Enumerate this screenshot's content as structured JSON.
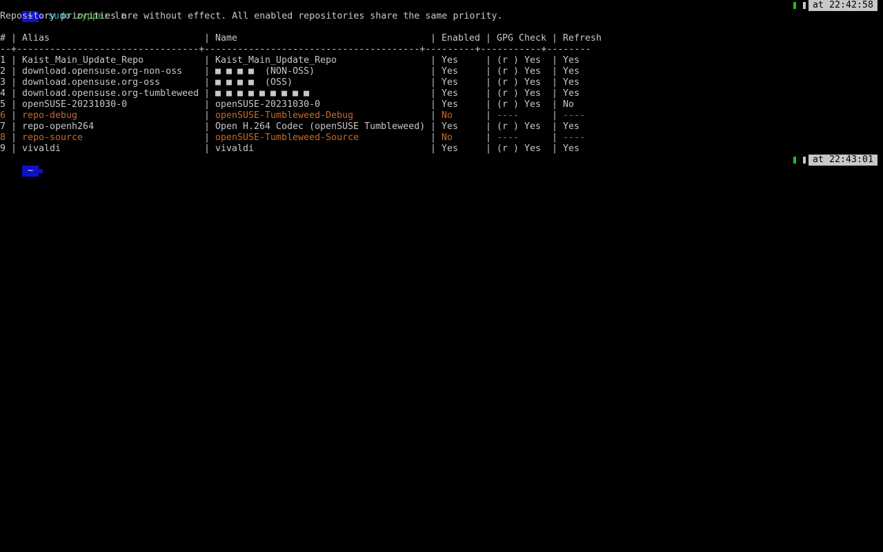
{
  "prompt1": {
    "home": "~",
    "cmd_sudo": "sudo",
    "cmd_zypper": "zypper",
    "cmd_arg": "lr",
    "time": "at 22:42:58"
  },
  "message": "Repository priorities are without effect. All enabled repositories share the same priority.",
  "table": {
    "headers": {
      "num": "#",
      "alias": "Alias",
      "name": "Name",
      "enabled": "Enabled",
      "gpg": "GPG Check",
      "refresh": "Refresh"
    },
    "divider": "--+---------------------------------+---------------------------------------+---------+-----------+--------",
    "rows": [
      {
        "num": "1",
        "alias": "Kaist_Main_Update_Repo",
        "name": "Kaist_Main_Update_Repo",
        "enabled": "Yes",
        "gpg": "(r ) Yes",
        "refresh": "Yes"
      },
      {
        "num": "2",
        "alias": "download.opensuse.org-non-oss",
        "name": "■ ■ ■ ■  (NON-OSS)",
        "enabled": "Yes",
        "gpg": "(r ) Yes",
        "refresh": "Yes"
      },
      {
        "num": "3",
        "alias": "download.opensuse.org-oss",
        "name": "■ ■ ■ ■  (OSS)",
        "enabled": "Yes",
        "gpg": "(r ) Yes",
        "refresh": "Yes"
      },
      {
        "num": "4",
        "alias": "download.opensuse.org-tumbleweed",
        "name": "■ ■ ■ ■ ■ ■ ■ ■ ■",
        "enabled": "Yes",
        "gpg": "(r ) Yes",
        "refresh": "Yes"
      },
      {
        "num": "5",
        "alias": "openSUSE-20231030-0",
        "name": "openSUSE-20231030-0",
        "enabled": "Yes",
        "gpg": "(r ) Yes",
        "refresh": "No"
      },
      {
        "num": "6",
        "alias": "repo-debug",
        "name": "openSUSE-Tumbleweed-Debug",
        "enabled": "No",
        "gpg": "----",
        "refresh": "----"
      },
      {
        "num": "7",
        "alias": "repo-openh264",
        "name": "Open H.264 Codec (openSUSE Tumbleweed)",
        "enabled": "Yes",
        "gpg": "(r ) Yes",
        "refresh": "Yes"
      },
      {
        "num": "8",
        "alias": "repo-source",
        "name": "openSUSE-Tumbleweed-Source",
        "enabled": "No",
        "gpg": "----",
        "refresh": "----"
      },
      {
        "num": "9",
        "alias": "vivaldi",
        "name": "vivaldi",
        "enabled": "Yes",
        "gpg": "(r ) Yes",
        "refresh": "Yes"
      }
    ]
  },
  "prompt2": {
    "home": "~",
    "time": "at 22:43:01"
  },
  "colors": {
    "background": "#000000",
    "text": "#c8c8c8",
    "disabled": "#c86a28",
    "prompt_bg": "#1010c8",
    "sudo": "#28b8c8",
    "zypper": "#30c830"
  }
}
